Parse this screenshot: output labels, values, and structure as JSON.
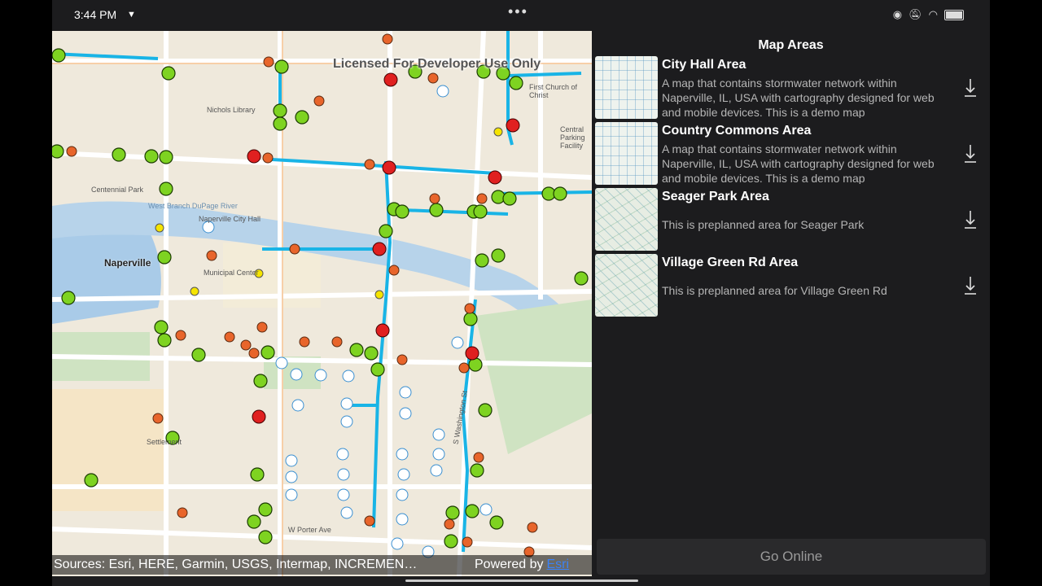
{
  "status_bar": {
    "time": "3:44 PM"
  },
  "map": {
    "license_text": "Licensed For Developer Use Only",
    "place_label": "Naperville",
    "street_labels": [
      "Nichols Library",
      "West Branch DuPage River",
      "Naperville City Hall",
      "Municipal Center",
      "W Porter Ave",
      "S Washington St",
      "Centennial Park",
      "First Church of Christ",
      "Central Parking Facility",
      "Settlement"
    ],
    "attribution_sources": "Sources: Esri, HERE, Garmin, USGS, Intermap, INCREMEN…",
    "attribution_powered": "Powered by",
    "attribution_link": "Esri"
  },
  "panel": {
    "title": "Map Areas",
    "areas": [
      {
        "name": "City Hall Area",
        "description": "A map that contains stormwater network within Naperville, IL, USA with cartography designed for web and mobile devices. This is a demo map"
      },
      {
        "name": "Country Commons Area",
        "description": "A map that contains stormwater network within Naperville, IL, USA with cartography designed for web and mobile devices. This is a demo map"
      },
      {
        "name": "Seager Park Area",
        "description": "This is preplanned area for Seager Park"
      },
      {
        "name": "Village Green Rd Area",
        "description": "This is preplanned area for Village Green Rd"
      }
    ],
    "go_online_label": "Go Online"
  },
  "icons": {
    "download": "download-icon",
    "location": "location-icon",
    "notification": "bell-off-icon",
    "wifi": "wifi-icon",
    "battery": "battery-icon"
  },
  "colors": {
    "pipe": "#19b4e6",
    "inlet_green": "#7ed321",
    "manhole_orange": "#e8652b",
    "red_marker": "#e02020",
    "panel_bg": "#1c1c1e"
  }
}
